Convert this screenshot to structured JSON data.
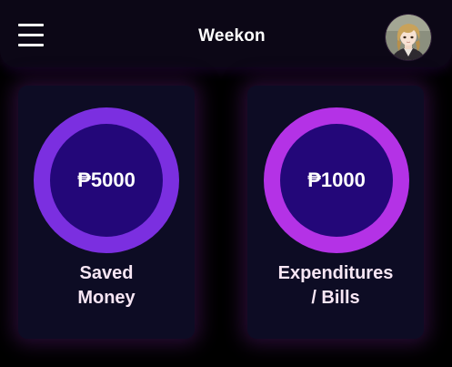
{
  "header": {
    "menu_icon": "hamburger-menu-icon",
    "title": "Weekon",
    "avatar_icon": "user-avatar"
  },
  "cards": [
    {
      "amount": "₱5000",
      "label_line1": "Saved",
      "label_line2": "Money",
      "ring_color": "#7b2fe0",
      "inner_color": "#230779"
    },
    {
      "amount": "₱1000",
      "label_line1": "Expenditures",
      "label_line2": "/ Bills",
      "ring_color": "#b432e6",
      "inner_color": "#230779"
    }
  ],
  "colors": {
    "background": "#000000",
    "header_bg": "#0c0716",
    "card_bg": "#0d0c24",
    "label_text": "#f7e6f4"
  }
}
